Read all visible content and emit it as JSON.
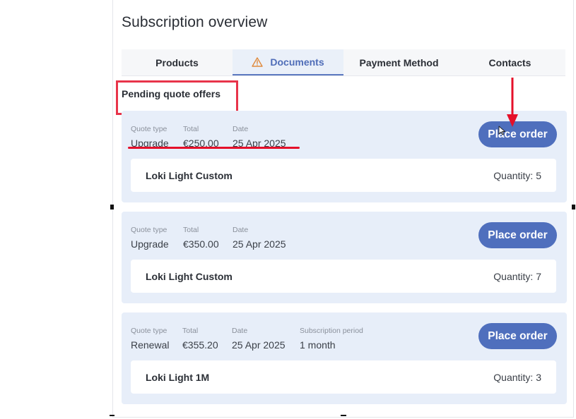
{
  "page": {
    "title": "Subscription overview"
  },
  "tabs": [
    {
      "label": "Products",
      "active": false
    },
    {
      "label": "Documents",
      "active": true,
      "icon": "warning-triangle-icon"
    },
    {
      "label": "Payment Method",
      "active": false
    },
    {
      "label": "Contacts",
      "active": false
    }
  ],
  "section": {
    "label": "Pending quote offers"
  },
  "quotes": [
    {
      "labels": {
        "type": "Quote type",
        "total": "Total",
        "date": "Date"
      },
      "type": "Upgrade",
      "total": "€250.00",
      "date": "25 Apr 2025",
      "button": "Place order",
      "product": {
        "name": "Loki Light Custom",
        "quantity": "Quantity: 5"
      }
    },
    {
      "labels": {
        "type": "Quote type",
        "total": "Total",
        "date": "Date"
      },
      "type": "Upgrade",
      "total": "€350.00",
      "date": "25 Apr 2025",
      "button": "Place order",
      "product": {
        "name": "Loki Light Custom",
        "quantity": "Quantity: 7"
      }
    },
    {
      "labels": {
        "type": "Quote type",
        "total": "Total",
        "date": "Date",
        "period": "Subscription period"
      },
      "type": "Renewal",
      "total": "€355.20",
      "date": "25 Apr 2025",
      "period": "1 month",
      "button": "Place order",
      "product": {
        "name": "Loki Light 1M",
        "quantity": "Quantity: 3"
      }
    }
  ],
  "colors": {
    "accent": "#4f6fbd",
    "card_bg": "#e7eef9",
    "annotation_red": "#e5102a",
    "warning_icon": "#e08a3c"
  }
}
